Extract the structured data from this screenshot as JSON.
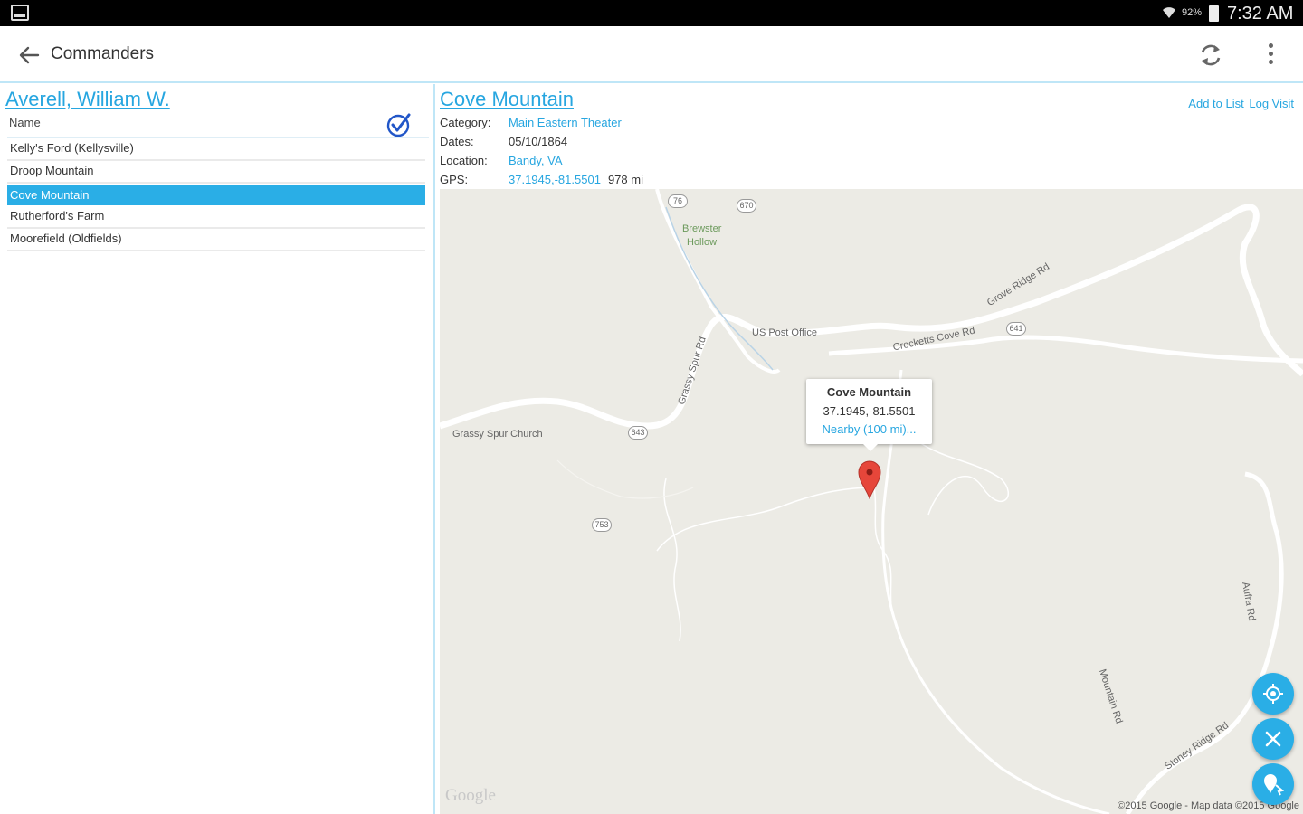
{
  "status_bar": {
    "battery_percent": "92%",
    "time": "7:32 AM"
  },
  "toolbar": {
    "title": "Commanders"
  },
  "left": {
    "commander_name": "Averell, William W.",
    "column_header": "Name",
    "battles": [
      {
        "name": "Kelly's Ford (Kellysville)"
      },
      {
        "name": "Droop Mountain"
      },
      {
        "name": "Cove Mountain"
      },
      {
        "name": "Rutherford's Farm"
      },
      {
        "name": "Moorefield (Oldfields)"
      }
    ]
  },
  "detail": {
    "title": "Cove Mountain",
    "add_to_list": "Add to List",
    "log_visit": "Log Visit",
    "category_label": "Category:",
    "category_value": "Main Eastern Theater",
    "dates_label": "Dates:",
    "dates_value": "05/10/1864",
    "location_label": "Location:",
    "location_value": "Bandy, VA",
    "gps_label": "GPS:",
    "gps_value": "37.1945,-81.5501",
    "distance": "978 mi"
  },
  "map": {
    "labels": {
      "brewster": "Brewster",
      "hollow": "Hollow",
      "post_office": "US Post Office",
      "grassy_church": "Grassy Spur Church",
      "crockett_rd": "Crocketts Cove Rd",
      "grove_rd": "Grove Ridge Rd",
      "grassy_rd": "Grassy Spur Rd",
      "aufra_rd": "Aufra Rd",
      "stoney_rd": "Stoney Ridge Rd",
      "mining_rd": "Mountain Rd"
    },
    "routes": {
      "r1": "76",
      "r2": "670",
      "r3": "641",
      "r4": "643",
      "r5": "753"
    },
    "callout": {
      "title": "Cove Mountain",
      "gps": "37.1945,-81.5501",
      "nearby": "Nearby (100 mi)..."
    },
    "logo": "Google",
    "copyright": "©2015 Google - Map data ©2015 Google"
  }
}
